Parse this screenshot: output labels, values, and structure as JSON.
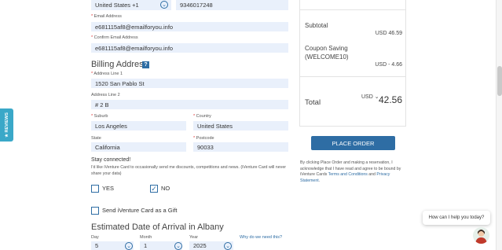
{
  "phone": {
    "country_value": "United States +1",
    "number_value": "9346017248"
  },
  "email": {
    "label": "Email Address",
    "value": "e681115af8@emailforyou.info"
  },
  "confirm_email": {
    "label": "Confirm Email Address",
    "value": "e681115af8@emailforyou.info"
  },
  "billing": {
    "heading": "Billing Address",
    "help": "?",
    "address1_label": "Address Line 1",
    "address1_value": "1520 San Pablo St",
    "address2_label": "Address Line 2",
    "address2_value": "# 2 B",
    "suburb_label": "Suburb",
    "suburb_value": "Los Angeles",
    "country_label": "Country",
    "country_value": "United States",
    "state_label": "State",
    "state_value": "California",
    "postcode_label": "Postcode",
    "postcode_value": "90033"
  },
  "stay_connected": {
    "heading": "Stay connected!",
    "text": "I'd like iVenture Card to occasionally send me discounts, competitions and news. (iVenture Card will never share your data)",
    "yes_label": "YES",
    "no_label": "NO",
    "no_checked": true
  },
  "gift": {
    "label": "Send iVenture Card as a Gift"
  },
  "arrival": {
    "heading": "Estimated Date of Arrival in Albany",
    "day_label": "Day",
    "day_value": "5",
    "month_label": "Month",
    "month_value": "1",
    "year_label": "Year",
    "year_value": "2025",
    "why_link": "Why do we need this?"
  },
  "summary": {
    "subtotal_label": "Subtotal",
    "subtotal_value": "USD 46.59",
    "coupon_label": "Coupon Saving",
    "coupon_code": "(WELCOME10)",
    "coupon_value": "USD - 4.66",
    "total_label": "Total",
    "currency": "USD",
    "total_value": "42.56"
  },
  "place_order": {
    "button": "PLACE ORDER",
    "legal_prefix": "By clicking Place Order and making a reservation, I acknowledge that I have read and agree to be bound by iVenture Cards ",
    "terms_link": "Terms and Conditions",
    "and": " and ",
    "privacy_link": "Privacy Statement",
    "end": "."
  },
  "reviews_tab": "★ REVIEWS",
  "chat": {
    "bubble": "How can I help you today?"
  },
  "colors": {
    "accent": "#2e6da4",
    "field_bg": "#e9f0fb",
    "reviews": "#3aa8c8"
  }
}
